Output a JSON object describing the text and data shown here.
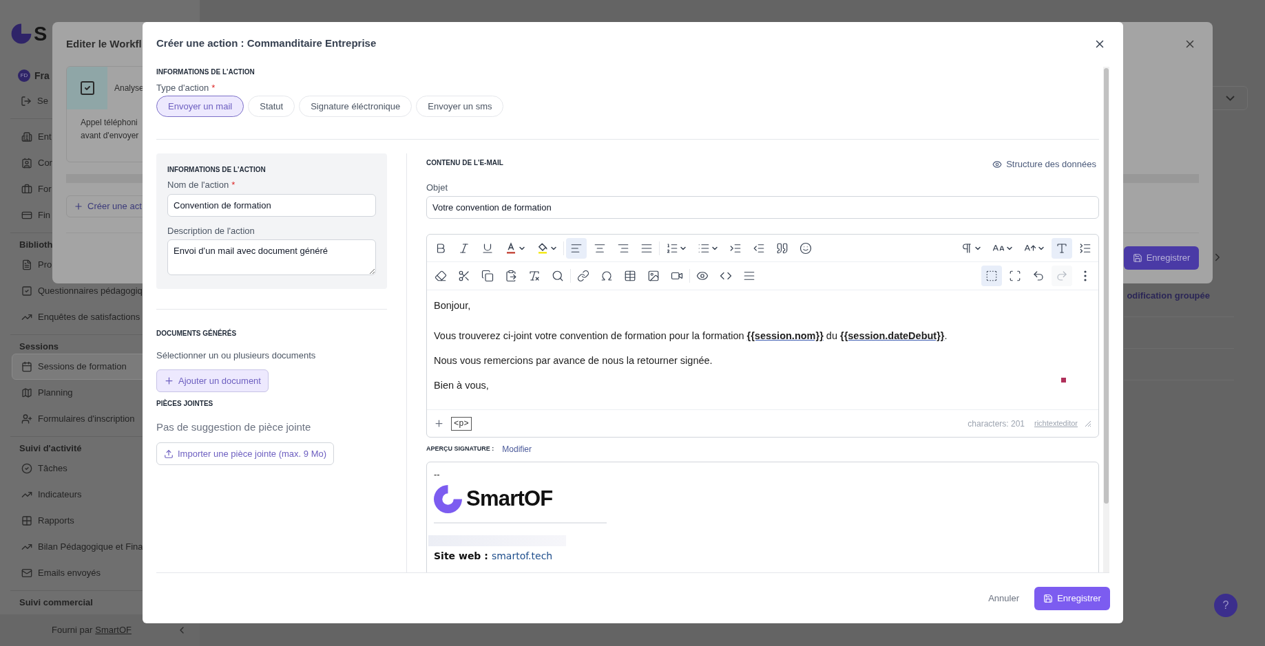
{
  "sidebar": {
    "logo_text": "S",
    "user": {
      "initials": "FD",
      "name": "Fra"
    },
    "logout": "Se",
    "groups": [
      {
        "items": [
          {
            "label": "Ent",
            "selected": false
          },
          {
            "label": "Con",
            "selected": false
          },
          {
            "label": "For",
            "selected": false
          },
          {
            "label": "Fin",
            "selected": false
          }
        ]
      },
      {
        "title": "Biblioth",
        "items": [
          {
            "label": "Pro",
            "selected": false
          },
          {
            "label": "Questionnaires pédagogiq",
            "selected": false
          },
          {
            "label": "Enquêtes de satisfactions",
            "selected": false
          }
        ]
      },
      {
        "title": "Sessions",
        "items": [
          {
            "label": "Sessions de formation",
            "selected": true
          },
          {
            "label": "Planning",
            "selected": false
          },
          {
            "label": "Formulaires d'inscription",
            "selected": false
          }
        ]
      },
      {
        "title": "Suivi d'activité",
        "items": [
          {
            "label": "Tâches",
            "selected": false
          },
          {
            "label": "Indicateurs",
            "selected": false
          },
          {
            "label": "Rapports",
            "selected": false
          },
          {
            "label": "Bilan Pédagogique et Fina",
            "selected": false
          },
          {
            "label": "Emails envoyés",
            "selected": false
          }
        ]
      },
      {
        "title": "Suivi commercial"
      }
    ],
    "footer": {
      "text": "Fourni par",
      "link": "SmartOF"
    }
  },
  "page": {
    "table_header": "odification groupée",
    "help_button": "?"
  },
  "workflow_dialog": {
    "title": "Editer le Workfl",
    "step": {
      "title": "Analyse",
      "description_lines": [
        "Appel téléphoni",
        "avant d'envoyer"
      ]
    },
    "create_button": "Créer une act",
    "save_button": "Enregistrer"
  },
  "dialog": {
    "title": "Créer une action : Commanditaire Entreprise",
    "section_title": "INFORMATIONS DE L'ACTION",
    "type_label": {
      "text": "Type d'action",
      "required_mark": "*"
    },
    "action_types": [
      {
        "label": "Envoyer un mail",
        "selected": true
      },
      {
        "label": "Statut",
        "selected": false
      },
      {
        "label": "Signature éléctronique",
        "selected": false
      },
      {
        "label": "Envoyer un sms",
        "selected": false
      }
    ],
    "info_card": {
      "title": "INFORMATIONS DE L'ACTION",
      "name_label": {
        "text": "Nom de l'action",
        "required_mark": "*"
      },
      "name_value": "Convention de formation",
      "description_label": "Description de l'action",
      "description_value": "Envoi d’un mail avec document généré"
    },
    "documents": {
      "title": "DOCUMENTS GÉNÉRÉS",
      "hint": "Sélectionner un ou plusieurs documents",
      "add_button": "Ajouter un document"
    },
    "attachments": {
      "title": "PIÈCES JOINTES",
      "empty_text": "Pas de suggestion de pièce jointe",
      "import_button": "Importer une pièce jointe (max. 9 Mo)"
    },
    "email": {
      "title": "CONTENU DE L'E-MAIL",
      "data_structure_link": "Structure des données",
      "subject_label": "Objet",
      "subject_value": "Votre convention de formation",
      "toolbar": [
        {
          "left": [
            [
              {
                "kind": "bold",
                "selected": false,
                "disabled": false
              },
              {
                "kind": "italic",
                "selected": false,
                "disabled": false
              },
              {
                "kind": "underline",
                "selected": false,
                "disabled": false
              },
              {
                "kind": "text-color",
                "selected": false,
                "disabled": false
              },
              {
                "kind": "highlight",
                "selected": false,
                "disabled": false
              }
            ],
            [
              {
                "kind": "align-left",
                "selected": true,
                "disabled": false
              },
              {
                "kind": "align-center",
                "selected": false,
                "disabled": false
              },
              {
                "kind": "align-right",
                "selected": false,
                "disabled": false
              },
              {
                "kind": "align-justify",
                "selected": false,
                "disabled": false
              }
            ],
            [
              {
                "kind": "numbered-list",
                "selected": false,
                "disabled": false
              },
              {
                "kind": "bullet-list",
                "selected": false,
                "disabled": false
              },
              {
                "kind": "indent",
                "selected": false,
                "disabled": false
              },
              {
                "kind": "outdent",
                "selected": false,
                "disabled": false
              },
              {
                "kind": "quote",
                "selected": false,
                "disabled": false
              },
              {
                "kind": "emoji",
                "selected": false,
                "disabled": false
              }
            ]
          ],
          "right": [
            [
              {
                "kind": "paragraph",
                "selected": false,
                "disabled": false
              },
              {
                "kind": "text-size",
                "selected": false,
                "disabled": false
              },
              {
                "kind": "font-size",
                "selected": false,
                "disabled": false
              },
              {
                "kind": "text-style",
                "selected": true,
                "disabled": false
              },
              {
                "kind": "line-height",
                "selected": false,
                "disabled": false
              }
            ]
          ]
        },
        {
          "left": [
            [
              {
                "kind": "eraser",
                "selected": false,
                "disabled": false
              },
              {
                "kind": "cut",
                "selected": false,
                "disabled": false
              },
              {
                "kind": "copy",
                "selected": false,
                "disabled": false
              },
              {
                "kind": "paste",
                "selected": false,
                "disabled": false
              },
              {
                "kind": "clear-format",
                "selected": false,
                "disabled": false
              },
              {
                "kind": "search",
                "selected": false,
                "disabled": false
              }
            ],
            [
              {
                "kind": "link",
                "selected": false,
                "disabled": false
              },
              {
                "kind": "symbol",
                "selected": false,
                "disabled": false
              },
              {
                "kind": "table",
                "selected": false,
                "disabled": false
              },
              {
                "kind": "image",
                "selected": false,
                "disabled": false
              },
              {
                "kind": "video",
                "selected": false,
                "disabled": false
              }
            ],
            [
              {
                "kind": "preview",
                "selected": false,
                "disabled": false
              },
              {
                "kind": "code",
                "selected": false,
                "disabled": false
              },
              {
                "kind": "select-all",
                "selected": false,
                "disabled": false
              }
            ]
          ],
          "right": [
            [
              {
                "kind": "blocks",
                "selected": true,
                "disabled": false
              },
              {
                "kind": "fullscreen",
                "selected": false,
                "disabled": false
              },
              {
                "kind": "undo",
                "selected": false,
                "disabled": false
              },
              {
                "kind": "redo",
                "selected": false,
                "disabled": true
              },
              {
                "kind": "more",
                "selected": false,
                "disabled": false
              }
            ]
          ]
        }
      ],
      "paragraphs": [
        "Bonjour,",
        "Vous trouverez ci-joint votre convention de formation pour la formation **{{session.nom}}** du **{{session.dateDebut}}**.",
        "Nous vous remercions par avance de nous la retourner signée.",
        "Bien à vous,"
      ],
      "footer": {
        "block_tag": "<p>",
        "characters": "characters: 201",
        "brand_link": "richtexteditor"
      }
    },
    "signature": {
      "title": "APERÇU SIGNATURE :",
      "edit_link": "Modifier",
      "separator": "--",
      "logo_text": "SmartOF",
      "website_label": "Site web :",
      "website_link": "smartof.tech"
    },
    "cancel_button": "Annuler",
    "save_button": "Enregistrer"
  }
}
